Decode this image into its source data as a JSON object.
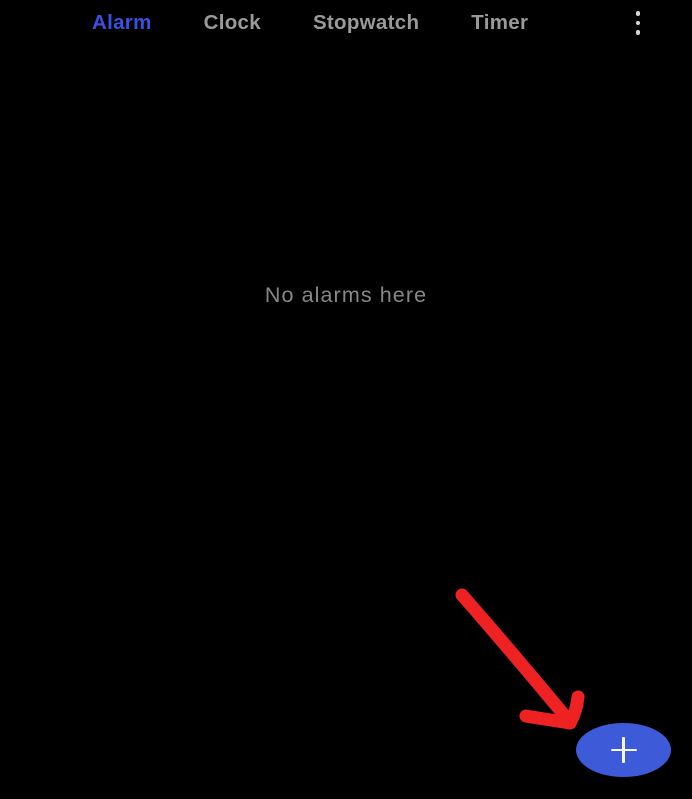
{
  "app": {
    "name": "Clock",
    "screen": "Alarm",
    "background_color": "#000000"
  },
  "tabbar": {
    "active_index": 0,
    "active_color": "#3b4fe0",
    "inactive_color": "#9a9a9a",
    "tabs": [
      {
        "label": "Alarm",
        "active": true
      },
      {
        "label": "Clock",
        "active": false
      },
      {
        "label": "Stopwatch",
        "active": false
      },
      {
        "label": "Timer",
        "active": false
      }
    ],
    "overflow": {
      "icon": "more-vertical-icon",
      "label": "More options",
      "dot_color": "#d6d6d6"
    }
  },
  "main": {
    "empty_state": {
      "message": "No alarms here",
      "text_color": "#878787"
    }
  },
  "fab": {
    "icon": "plus-icon",
    "label": "Add alarm",
    "background_color": "#3d5ad9",
    "icon_color": "#f2f4ff"
  },
  "annotation": {
    "type": "arrow",
    "name": "red-pointer-arrow",
    "color": "#ee2222",
    "points_to": "fab",
    "stroke_width": 13
  }
}
